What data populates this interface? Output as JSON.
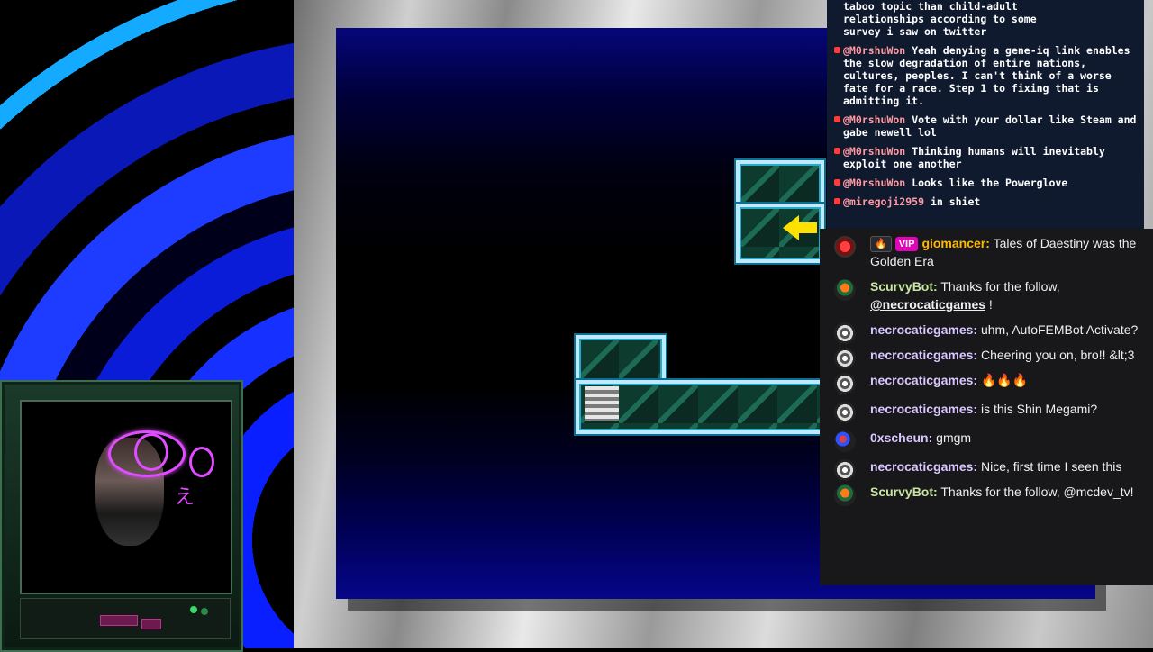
{
  "overlay_chat": {
    "partial_top_text": [
      "taboo topic than child-adult",
      "relationships according to some",
      "survey i saw on twitter"
    ],
    "messages": [
      {
        "user": "@M0rshuWon",
        "text": "Yeah denying a gene-iq link enables the slow degradation of entire nations, cultures, peoples. I can't think of a worse fate for a race. Step 1 to fixing that is admitting it."
      },
      {
        "user": "@M0rshuWon",
        "text": "Vote with your dollar like Steam and gabe newell lol"
      },
      {
        "user": "@M0rshuWon",
        "text": "Thinking humans will inevitably exploit one another"
      },
      {
        "user": "@M0rshuWon",
        "text": "Looks like the Powerglove"
      },
      {
        "user": "@miregoji2959",
        "text": "in shiet"
      }
    ]
  },
  "chat": {
    "messages": [
      {
        "user": "giomancer",
        "user_color": "#ffb800",
        "badges": [
          "🔥",
          "VIP"
        ],
        "text": "Tales of Daestiny was the Golden Era",
        "avatar": "gio-avatar"
      },
      {
        "user": "ScurvyBot",
        "user_color": "#c8e6a0",
        "text_before": "Thanks for the follow,",
        "mention": "@necrocaticgames",
        "text_after": " !",
        "avatar": "scurvy-avatar"
      },
      {
        "user": "necrocaticgames",
        "user_color": "#d9c7ff",
        "text": "uhm, AutoFEMBot Activate?",
        "avatar": "necro-avatar"
      },
      {
        "user": "necrocaticgames",
        "user_color": "#d9c7ff",
        "text": "Cheering you on, bro!! &lt;3",
        "avatar": "necro-avatar"
      },
      {
        "user": "necrocaticgames",
        "user_color": "#d9c7ff",
        "text": "🔥🔥🔥",
        "avatar": "necro-avatar"
      },
      {
        "user": "necrocaticgames",
        "user_color": "#d9c7ff",
        "text": "is this Shin Megami?",
        "avatar": "necro-avatar"
      },
      {
        "user": "0xscheun",
        "user_color": "#d9c7ff",
        "text": "gmgm",
        "avatar": "oxs-avatar"
      },
      {
        "user": "necrocaticgames",
        "user_color": "#d9c7ff",
        "text": "Nice, first time I seen this",
        "avatar": "necro-avatar"
      },
      {
        "user": "ScurvyBot",
        "user_color": "#c8e6a0",
        "text": "Thanks for the follow, @mcdev_tv!",
        "avatar": "scurvy-avatar"
      }
    ]
  },
  "webcam": {
    "kana": "え"
  },
  "colors": {
    "vip_badge": "#e005b9",
    "chat_bg": "#18181b",
    "overlay_bg": "#0f1a2e",
    "accent_pink": "#e04cff"
  }
}
